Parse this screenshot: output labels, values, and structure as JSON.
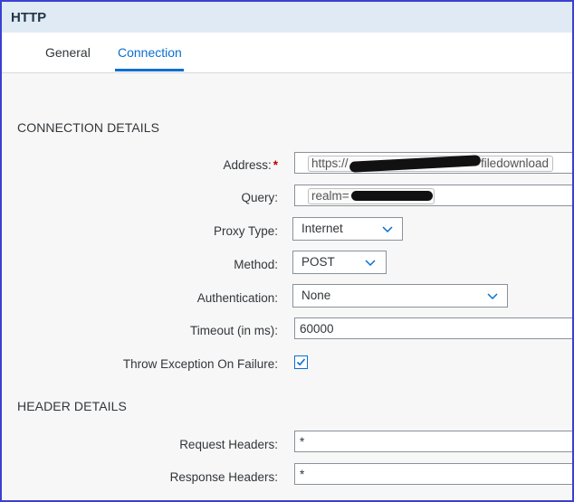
{
  "window": {
    "title": "HTTP"
  },
  "tabs": [
    {
      "label": "General",
      "active": false
    },
    {
      "label": "Connection",
      "active": true
    }
  ],
  "connection_details": {
    "section_title": "CONNECTION DETAILS",
    "address": {
      "label": "Address:",
      "required_mark": "*",
      "value_prefix": "https://",
      "value_suffix": "filedownload"
    },
    "query": {
      "label": "Query:",
      "value_prefix": "realm="
    },
    "proxy_type": {
      "label": "Proxy Type:",
      "value": "Internet"
    },
    "method": {
      "label": "Method:",
      "value": "POST"
    },
    "authentication": {
      "label": "Authentication:",
      "value": "None"
    },
    "timeout": {
      "label": "Timeout (in ms):",
      "value": "60000"
    },
    "throw_exception": {
      "label": "Throw Exception On Failure:",
      "checked": true
    }
  },
  "header_details": {
    "section_title": "HEADER DETAILS",
    "request_headers": {
      "label": "Request Headers:",
      "value": "*"
    },
    "response_headers": {
      "label": "Response Headers:",
      "value": "*"
    }
  },
  "colors": {
    "accent": "#0a6ed1",
    "required": "#bb0000",
    "titlebar": "#dfeaf5",
    "frame_border": "#3b3fd1"
  },
  "icons": {
    "dropdown": "chevron-down-icon",
    "checkbox": "checkmark-icon"
  }
}
